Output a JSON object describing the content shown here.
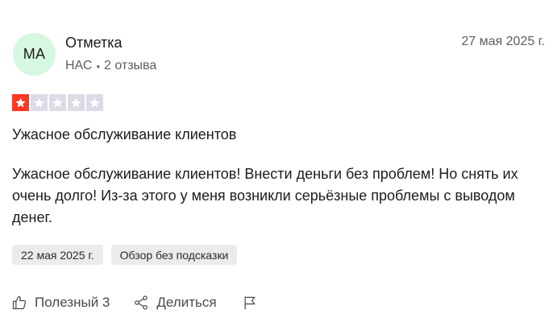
{
  "reviewer": {
    "initials": "МА",
    "name": "Отметка",
    "country": "НАС",
    "review_count": "2 отзыва"
  },
  "review": {
    "date": "27 мая 2025 г.",
    "rating": 1,
    "rating_max": 5,
    "title": "Ужасное обслуживание клиентов",
    "body": "Ужасное обслуживание клиентов! Внести деньги без проблем! Но снять их очень долго! Из-за этого у меня возникли серьёзные проблемы с выводом денег.",
    "experience_date": "22 мая 2025 г.",
    "tag": "Обзор без подсказки"
  },
  "actions": {
    "helpful_label": "Полезный 3",
    "share_label": "Делиться",
    "report_icon": "flag-icon"
  },
  "colors": {
    "star_filled": "#ff3722",
    "star_empty": "#dcdce6",
    "avatar_bg": "#d6f7e1",
    "tag_bg": "#ebebeb"
  }
}
